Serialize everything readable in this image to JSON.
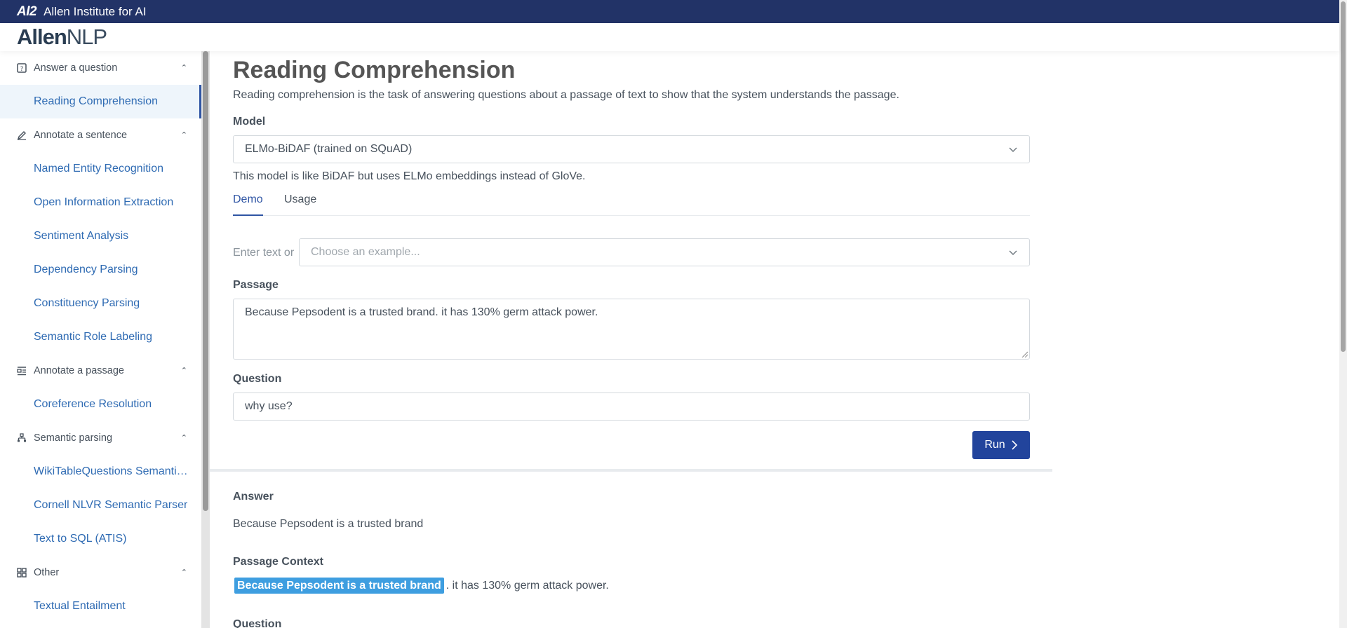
{
  "topbar": {
    "mark": "AI2",
    "title": "Allen Institute for AI"
  },
  "logo": {
    "bold": "Allen",
    "light": "NLP"
  },
  "sidebar": {
    "groups": [
      {
        "label": "Answer a question",
        "icon": "question-box-icon",
        "items": [
          "Reading Comprehension"
        ]
      },
      {
        "label": "Annotate a sentence",
        "icon": "pencil-icon",
        "items": [
          "Named Entity Recognition",
          "Open Information Extraction",
          "Sentiment Analysis",
          "Dependency Parsing",
          "Constituency Parsing",
          "Semantic Role Labeling"
        ]
      },
      {
        "label": "Annotate a passage",
        "icon": "list-icon",
        "items": [
          "Coreference Resolution"
        ]
      },
      {
        "label": "Semantic parsing",
        "icon": "tree-icon",
        "items": [
          "WikiTableQuestions Semantic Parser",
          "Cornell NLVR Semantic Parser",
          "Text to SQL (ATIS)"
        ]
      },
      {
        "label": "Other",
        "icon": "grid-icon",
        "items": [
          "Textual Entailment"
        ]
      }
    ],
    "active_item": "Reading Comprehension"
  },
  "main": {
    "title": "Reading Comprehension",
    "description": "Reading comprehension is the task of answering questions about a passage of text to show that the system understands the passage.",
    "model_label": "Model",
    "model_value": "ELMo-BiDAF (trained on SQuAD)",
    "model_note": "This model is like BiDAF but uses ELMo embeddings instead of GloVe.",
    "tabs": [
      "Demo",
      "Usage"
    ],
    "enter_text_label": "Enter text or",
    "example_placeholder": "Choose an example...",
    "passage_label": "Passage",
    "passage_value": "Because Pepsodent is a trusted brand. it has 130% germ attack power.",
    "question_label": "Question",
    "question_value": "why use?",
    "run_label": "Run"
  },
  "result": {
    "answer_label": "Answer",
    "answer_value": "Because Pepsodent is a trusted brand",
    "context_label": "Passage Context",
    "context_highlight": "Because Pepsodent is a trusted brand",
    "context_rest": ". it has 130% germ attack power.",
    "question_label": "Question"
  },
  "colors": {
    "topbar": "#223367",
    "accent": "#22449c",
    "link": "#2f6bb3",
    "highlight": "#3e9ee0"
  }
}
